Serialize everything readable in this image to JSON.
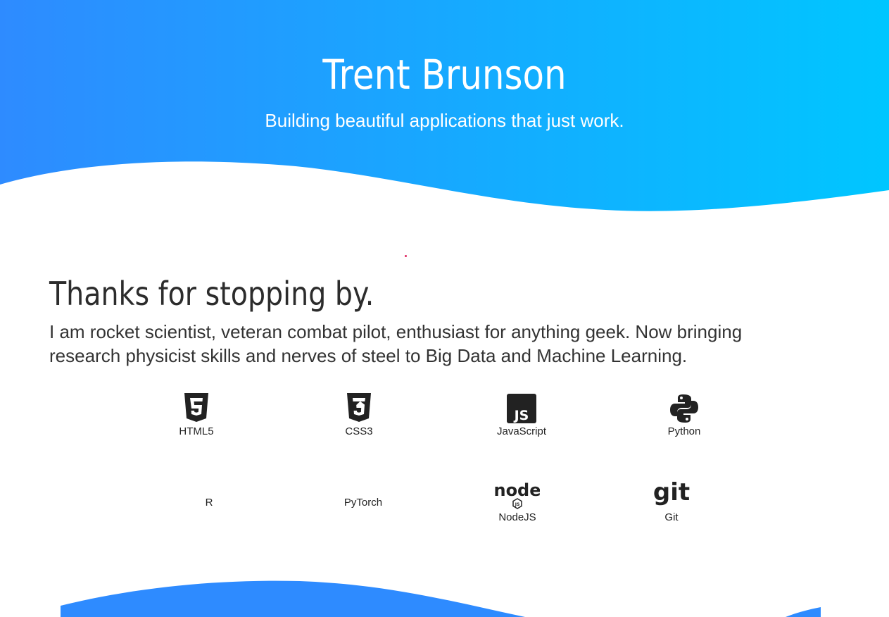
{
  "hero": {
    "title": "Trent Brunson",
    "subtitle": "Building beautiful applications that just work.",
    "gradient_start": "#2e8bff",
    "gradient_end": "#00c6ff"
  },
  "intro": {
    "heading": "Thanks for stopping by.",
    "body": "I am rocket scientist, veteran combat pilot, enthusiast for anything geek. Now bringing research physicist skills and nerves of steel to Big Data and Machine Learning."
  },
  "skills": [
    {
      "name": "HTML5",
      "icon": "html5-icon"
    },
    {
      "name": "CSS3",
      "icon": "css3-icon"
    },
    {
      "name": "JavaScript",
      "icon": "javascript-icon"
    },
    {
      "name": "Python",
      "icon": "python-icon"
    },
    {
      "name": "R",
      "icon": ""
    },
    {
      "name": "PyTorch",
      "icon": ""
    },
    {
      "name": "NodeJS",
      "icon": "nodejs-icon"
    },
    {
      "name": "Git",
      "icon": "git-icon"
    }
  ],
  "colors": {
    "text": "#2c2c2c",
    "accent": "#2e8bff",
    "icon": "#222222"
  }
}
